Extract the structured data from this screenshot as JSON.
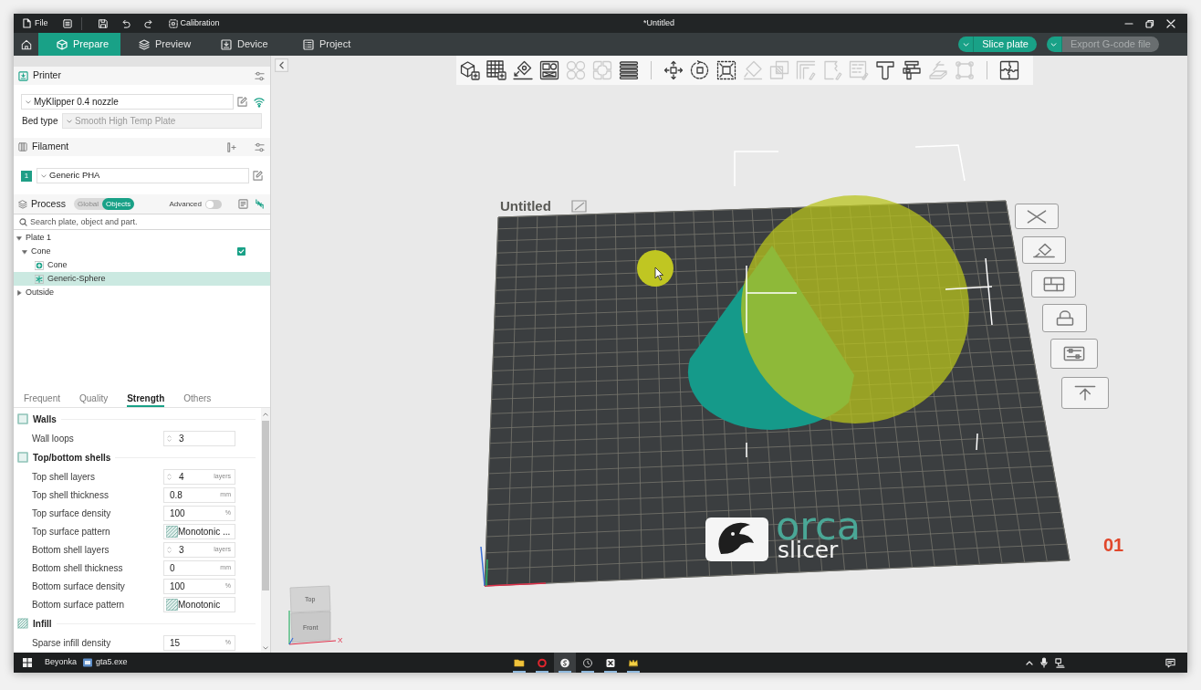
{
  "title_bar": {
    "menu": [
      {
        "label": "File"
      }
    ],
    "calibration": "Calibration",
    "title": "*Untitled"
  },
  "tabs": [
    {
      "label": "Prepare",
      "selected": true
    },
    {
      "label": "Preview",
      "selected": false
    },
    {
      "label": "Device",
      "selected": false
    },
    {
      "label": "Project",
      "selected": false
    }
  ],
  "actions": [
    {
      "label": "Slice plate",
      "disabled": false
    },
    {
      "label": "Export G-code file",
      "disabled": true
    }
  ],
  "sidebar": {
    "printer": {
      "title": "Printer",
      "preset": "MyKlipper 0.4 nozzle",
      "bed_type_label": "Bed type",
      "bed_type": "Smooth High Temp Plate"
    },
    "filament": {
      "title": "Filament",
      "slots": [
        {
          "index": "1",
          "name": "Generic PHA",
          "color": "#1f9e86"
        }
      ]
    },
    "process": {
      "title": "Process",
      "scope": [
        {
          "label": "Global",
          "selected": false
        },
        {
          "label": "Objects",
          "selected": true
        }
      ],
      "advanced_label": "Advanced",
      "advanced": false
    },
    "search": {
      "placeholder": "Search plate, object and part."
    },
    "tree": [
      {
        "label": "Plate 1",
        "expanded": true,
        "selected": false,
        "children": [
          {
            "label": "Cone",
            "expanded": true,
            "selected": false,
            "checked": true,
            "children": [
              {
                "label": "Cone",
                "kind": "part",
                "selected": false
              },
              {
                "label": "Generic-Sphere",
                "kind": "modifier",
                "selected": true
              }
            ]
          }
        ]
      },
      {
        "label": "Outside",
        "expanded": false,
        "selected": false
      }
    ],
    "settings_tabs": [
      {
        "label": "Frequent",
        "selected": false
      },
      {
        "label": "Quality",
        "selected": false
      },
      {
        "label": "Strength",
        "selected": true
      },
      {
        "label": "Others",
        "selected": false
      }
    ],
    "groups": [
      {
        "title": "Walls",
        "kind": "walls",
        "options": [
          {
            "label": "Wall loops",
            "kind": "spin",
            "value": "3"
          }
        ]
      },
      {
        "title": "Top/bottom shells",
        "kind": "shells",
        "options": [
          {
            "label": "Top shell layers",
            "kind": "spin",
            "value": "4",
            "unit": "layers"
          },
          {
            "label": "Top shell thickness",
            "kind": "number",
            "value": "0.8",
            "unit": "mm"
          },
          {
            "label": "Top surface density",
            "kind": "number",
            "value": "100",
            "unit": "%"
          },
          {
            "label": "Top surface pattern",
            "kind": "pattern",
            "value": "Monotonic ..."
          },
          {
            "label": "Bottom shell layers",
            "kind": "spin",
            "value": "3",
            "unit": "layers"
          },
          {
            "label": "Bottom shell thickness",
            "kind": "number",
            "value": "0",
            "unit": "mm"
          },
          {
            "label": "Bottom surface density",
            "kind": "number",
            "value": "100",
            "unit": "%"
          },
          {
            "label": "Bottom surface pattern",
            "kind": "pattern",
            "value": "Monotonic"
          }
        ]
      },
      {
        "title": "Infill",
        "kind": "infill",
        "options": [
          {
            "label": "Sparse infill density",
            "kind": "number",
            "value": "15",
            "unit": "%"
          }
        ]
      }
    ]
  },
  "viewport": {
    "toolbar": {
      "groups": [
        [
          {
            "disabled": false
          },
          {
            "disabled": false
          },
          {
            "disabled": false
          },
          {
            "disabled": false
          },
          {
            "disabled": true
          },
          {
            "disabled": true
          },
          {
            "disabled": false
          }
        ],
        [
          {
            "disabled": false
          },
          {
            "disabled": false
          },
          {
            "disabled": false
          },
          {
            "disabled": true
          },
          {
            "disabled": true
          },
          {
            "disabled": true
          },
          {
            "disabled": true
          },
          {
            "disabled": true
          },
          {
            "disabled": false
          },
          {
            "disabled": false
          },
          {
            "disabled": true
          },
          {
            "disabled": true
          }
        ],
        [
          {
            "disabled": false
          }
        ]
      ]
    },
    "plate": {
      "name": "Untitled",
      "number": "01",
      "logo_word": "orca",
      "logo_subtitle": "slicer"
    },
    "view_cube": {
      "top": "Top",
      "front": "Front",
      "axis": "X"
    }
  },
  "taskbar": {
    "items": [
      {
        "label": "Beyonka",
        "kind": "text"
      },
      {
        "label": "gta5.exe",
        "kind": "app"
      }
    ],
    "apps": [
      {
        "running": true,
        "active": false
      },
      {
        "running": true,
        "active": false
      },
      {
        "running": true,
        "active": true
      },
      {
        "running": true,
        "active": false
      },
      {
        "running": true,
        "active": false
      },
      {
        "running": true,
        "active": false
      }
    ]
  }
}
